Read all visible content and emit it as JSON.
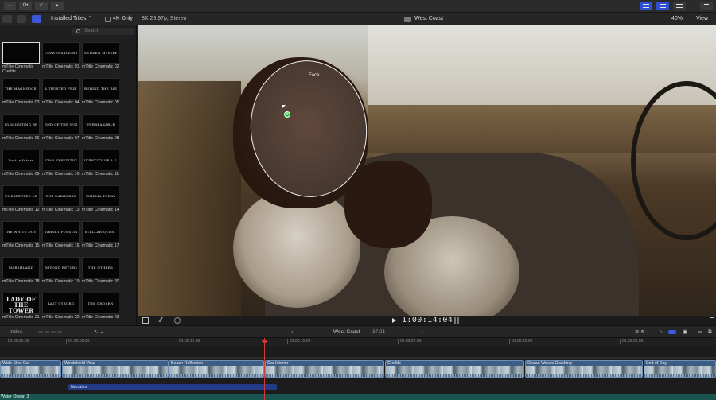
{
  "toolbar": {
    "import_label": "⇣",
    "keywords_label": "O•",
    "check_label": "✓",
    "tag_label": "▸"
  },
  "browser": {
    "category": "Installed Titles",
    "filter_label": "4K Only",
    "format": "8K 29.97p, Stereo",
    "clip_title": "West Coast",
    "zoom": "40%",
    "view_label": "View",
    "search_placeholder": "Search"
  },
  "titles": [
    {
      "caption": "mTitle Cinematic Credits",
      "art": "",
      "selected": true
    },
    {
      "caption": "mTitle Cinematic 01",
      "art": "CONVERSATIONALIST"
    },
    {
      "caption": "mTitle Cinematic 02",
      "art": "SUDDEN MYSTERY"
    },
    {
      "caption": "mTitle Cinematic 03",
      "art": "THE MAGNIFICENT MOUNTAIN"
    },
    {
      "caption": "mTitle Cinematic 04",
      "art": "A TRUSTED FRIEND"
    },
    {
      "caption": "mTitle Cinematic 05",
      "art": "BEHIND THE RED DOOR"
    },
    {
      "caption": "mTitle Cinematic 06",
      "art": "ELIMINATING BRUTAL"
    },
    {
      "caption": "mTitle Cinematic 07",
      "art": "END OF THE WORLD"
    },
    {
      "caption": "mTitle Cinematic 08",
      "art": "UNBREAKABLE"
    },
    {
      "caption": "mTitle Cinematic 09",
      "art": "Lost in future"
    },
    {
      "caption": "mTitle Cinematic 10",
      "art": "STAR EXPEDITION"
    },
    {
      "caption": "mTitle Cinematic 11",
      "art": "IDENTITY OF A SPY"
    },
    {
      "caption": "mTitle Cinematic 12",
      "art": "UNEXPECTED LETTER"
    },
    {
      "caption": "mTitle Cinematic 13",
      "art": "THE DARKNESS"
    },
    {
      "caption": "mTitle Cinematic 14",
      "art": "CINEMA TODAY"
    },
    {
      "caption": "mTitle Cinematic 15",
      "art": "THE WHITE DOVE"
    },
    {
      "caption": "mTitle Cinematic 16",
      "art": "TARGET PURSUIT"
    },
    {
      "caption": "mTitle Cinematic 17",
      "art": "STELLAR QUEST"
    },
    {
      "caption": "mTitle Cinematic 18",
      "art": "MARSHLAND"
    },
    {
      "caption": "mTitle Cinematic 19",
      "art": "BEYOND RETURNING PAST"
    },
    {
      "caption": "mTitle Cinematic 20",
      "art": "THE OTHERS"
    },
    {
      "caption": "mTitle Cinematic 21",
      "art": "LADY OF THE TOWER"
    },
    {
      "caption": "mTitle Cinematic 22",
      "art": "LAST CYBORG"
    },
    {
      "caption": "mTitle Cinematic 23",
      "art": "THE CHOSEN"
    }
  ],
  "viewer": {
    "face_label": "Face",
    "timecode": "1:00:14:04"
  },
  "timeline": {
    "index_label": "Index",
    "project_name": "West Coast",
    "duration": "37:21",
    "ruler": [
      "01:00:00:00",
      "01:00:05:00",
      "01:00:10:00",
      "01:00:15:00",
      "01:00:20:00",
      "01:00:25:00",
      "01:00:30:00"
    ],
    "clips": [
      {
        "name": "Wide Shot Car"
      },
      {
        "name": "Windshield View"
      },
      {
        "name": "Beach Reflection"
      },
      {
        "name": "Car Interior"
      },
      {
        "name": "Credits"
      },
      {
        "name": "Ocean Waves Crashing"
      },
      {
        "name": "End of Day"
      }
    ],
    "narration": "Narration",
    "music": "Water Ocean 3"
  }
}
